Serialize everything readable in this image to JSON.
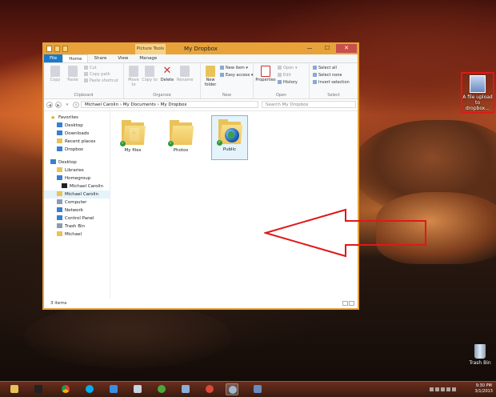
{
  "desktop": {
    "upload_icon_label": "A file upload to dropbox...",
    "trash_label": "Trash Bin"
  },
  "window": {
    "title": "My Dropbox",
    "context_tab": "Picture Tools",
    "controls": {
      "minimize": "—",
      "maximize": "☐",
      "close": "✕"
    },
    "tabs": [
      "File",
      "Home",
      "Share",
      "View",
      "Manage"
    ],
    "ribbon": {
      "clipboard": {
        "copy": "Copy",
        "paste": "Paste",
        "cut": "Cut",
        "copy_path": "Copy path",
        "paste_shortcut": "Paste shortcut",
        "label": "Clipboard"
      },
      "organize": {
        "move_to": "Move to",
        "copy_to": "Copy to",
        "delete": "Delete",
        "rename": "Rename",
        "label": "Organize"
      },
      "new": {
        "new_folder": "New folder",
        "new_item": "New item",
        "easy_access": "Easy access",
        "label": "New"
      },
      "open": {
        "properties": "Properties",
        "open": "Open",
        "edit": "Edit",
        "history": "History",
        "label": "Open"
      },
      "select": {
        "select_all": "Select all",
        "select_none": "Select none",
        "invert": "Invert selection",
        "label": "Select"
      }
    },
    "address": {
      "path": "Michael Carolin  ›  My Documents  ›  My Dropbox",
      "search_placeholder": "Search My Dropbox"
    },
    "nav": [
      {
        "label": "Favorites",
        "icon": "star"
      },
      {
        "label": "Desktop",
        "icon": "blue"
      },
      {
        "label": "Downloads",
        "icon": "blue"
      },
      {
        "label": "Recent places",
        "icon": "folder"
      },
      {
        "label": "Dropbox",
        "icon": "blue"
      },
      {
        "label": "Desktop",
        "icon": "blue"
      },
      {
        "label": "Libraries",
        "icon": "folder"
      },
      {
        "label": "Homegroup",
        "icon": "blue"
      },
      {
        "label": "Michael Carolin",
        "icon": "black"
      },
      {
        "label": "Michael Carolin",
        "icon": "folder"
      },
      {
        "label": "Computer",
        "icon": "drive"
      },
      {
        "label": "Network",
        "icon": "blue"
      },
      {
        "label": "Control Panel",
        "icon": "blue"
      },
      {
        "label": "Trash Bin",
        "icon": "drive"
      },
      {
        "label": "Michael",
        "icon": "folder"
      }
    ],
    "files": [
      {
        "name": "My files",
        "kind": "doc"
      },
      {
        "name": "Photos",
        "kind": "plain"
      },
      {
        "name": "Public",
        "kind": "globe"
      }
    ],
    "status": "3 items"
  },
  "taskbar": {
    "time": "9:30 PM",
    "date": "3/1/2013"
  },
  "colors": {
    "accent": "#e7a33a",
    "file_tab": "#1979ca",
    "close": "#c7504a",
    "callout": "#e01818"
  }
}
